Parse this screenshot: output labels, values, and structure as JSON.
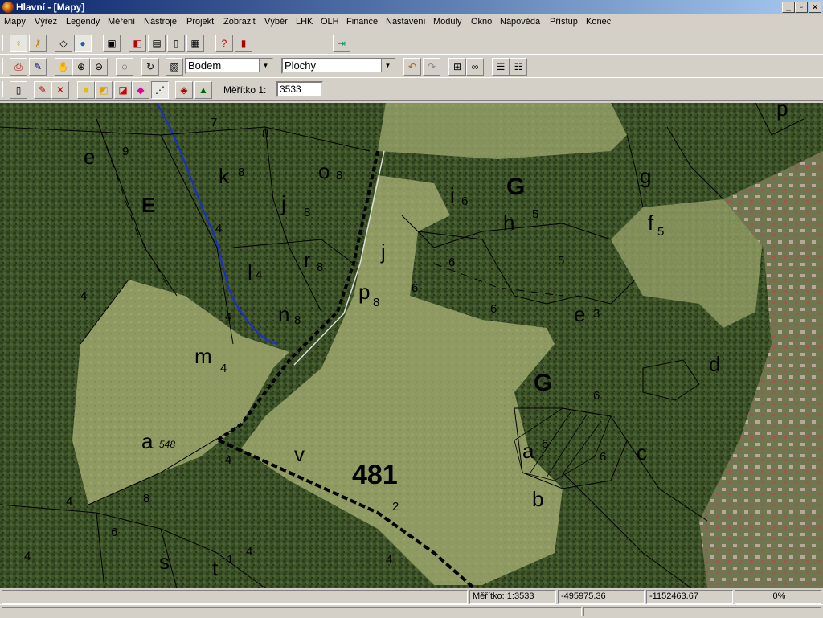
{
  "window": {
    "title": "Hlavní - [Mapy]"
  },
  "menu": [
    "Mapy",
    "Výřez",
    "Legendy",
    "Měření",
    "Nástroje",
    "Projekt",
    "Zobrazit",
    "Výběr",
    "LHK",
    "OLH",
    "Finance",
    "Nastavení",
    "Moduly",
    "Okno",
    "Nápověda",
    "Přístup",
    "Konec"
  ],
  "toolbar2": {
    "mode_value": "Bodem",
    "layer_value": "Plochy"
  },
  "toolbar3": {
    "scale_label": "Měřítko 1:",
    "scale_value": "3533"
  },
  "map_labels": {
    "E": "E",
    "e": "e",
    "n9": "9",
    "k": "k",
    "k_sub": "8",
    "j": "j",
    "j_sub": "8",
    "o": "o",
    "o_sub": "8",
    "G1": "G",
    "h": "h",
    "h_sub": "5",
    "i": "i",
    "i_sub": "6",
    "g": "g",
    "f": "f",
    "f_sub": "5",
    "l": "l",
    "l_sub": "4",
    "r": "r",
    "r_sub": "8",
    "p": "p",
    "p_sub": "8",
    "n": "n",
    "n_sub": "8",
    "m": "m",
    "m_sub": "4",
    "j2": "j",
    "e3": "e",
    "e3_sub": "3",
    "G2": "G",
    "d": "d",
    "a": "a",
    "a_val": "548",
    "v": "v",
    "parcel": "481",
    "n2": "2",
    "a2": "a",
    "a2_sub": "6",
    "c": "c",
    "b": "b",
    "s": "s",
    "t": "t",
    "t_sub": "1",
    "p_top": "p",
    "six1": "6",
    "six2": "6",
    "six3": "6",
    "six4": "6",
    "six5": "6",
    "six6": "6",
    "four1": "4",
    "four2": "4",
    "four3": "4",
    "four4": "4",
    "four5": "4",
    "four6": "4",
    "four7": "4",
    "eight1": "8",
    "eight2": "8",
    "seven1": "7",
    "five1": "5",
    "four8": "4"
  },
  "status": {
    "scale": "Měřítko: 1:3533",
    "x": "-495975.36",
    "y": "-1152463.67",
    "progress": "0%"
  }
}
